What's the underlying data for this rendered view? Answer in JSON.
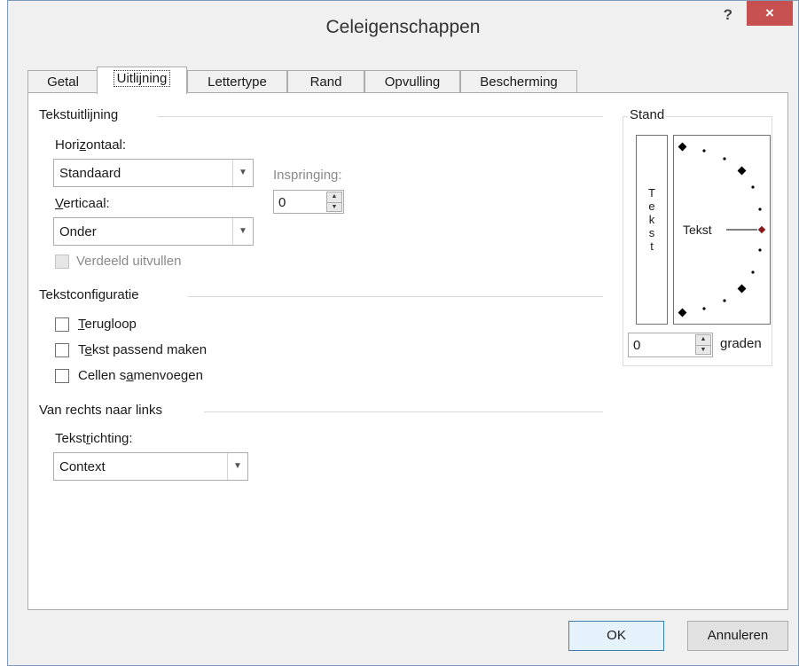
{
  "window": {
    "title": "Celeigenschappen",
    "help": "?",
    "close": "×"
  },
  "tabs": [
    {
      "label": "Getal"
    },
    {
      "label": "Uitlijning"
    },
    {
      "label": "Lettertype"
    },
    {
      "label": "Rand"
    },
    {
      "label": "Opvulling"
    },
    {
      "label": "Bescherming"
    }
  ],
  "text_alignment": {
    "title": "Tekstuitlijning",
    "horizontal": {
      "label_pre": "Hori",
      "label_u": "z",
      "label_post": "ontaal:",
      "value": "Standaard"
    },
    "indent": {
      "label": "Inspringing:",
      "value": "0"
    },
    "vertical": {
      "label_u": "V",
      "label_post": "erticaal:",
      "value": "Onder"
    },
    "distributed": {
      "label": "Verdeeld uitvullen"
    }
  },
  "text_control": {
    "title": "Tekstconfiguratie",
    "wrap": {
      "label_u": "T",
      "label_post": "erugloop"
    },
    "shrink": {
      "label_pre": "T",
      "label_u": "e",
      "label_post": "kst passend maken"
    },
    "merge": {
      "label_pre": "Cellen s",
      "label_u": "a",
      "label_post": "menvoegen"
    }
  },
  "rtl": {
    "title": "Van rechts naar links",
    "direction": {
      "label_pre": "Tekst",
      "label_u": "r",
      "label_post": "ichting:",
      "value": "Context"
    }
  },
  "orientation": {
    "title": "Stand",
    "vertical_text": [
      "T",
      "e",
      "k",
      "s",
      "t"
    ],
    "dial_text": "Tekst",
    "degrees_value": "0",
    "degrees_label_u": "g",
    "degrees_label_post": "raden",
    "accent_color": "#8b1a1a"
  },
  "buttons": {
    "ok": "OK",
    "cancel": "Annuleren"
  }
}
